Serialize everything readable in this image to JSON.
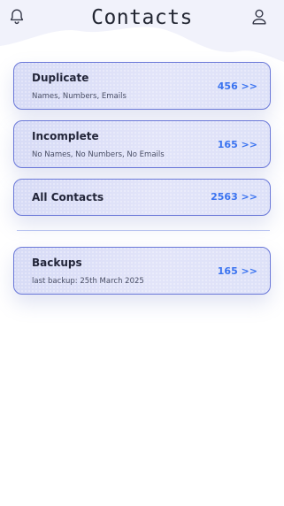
{
  "header": {
    "title": "Contacts"
  },
  "cards": [
    {
      "title": "Duplicate",
      "subtitle": "Names, Numbers, Emails",
      "count": "456 >>"
    },
    {
      "title": "Incomplete",
      "subtitle": "No Names, No Numbers, No Emails",
      "count": "165 >>"
    },
    {
      "title": "All Contacts",
      "count": "2563 >>"
    },
    {
      "title": "Backups",
      "subtitle": "last backup: 25th March 2025",
      "count": "165 >>"
    }
  ],
  "colors": {
    "accent": "#3a73f0",
    "card_border": "#6a78d8",
    "card_fill": "#dde1f8"
  },
  "icons": [
    "bell-icon",
    "user-icon"
  ]
}
